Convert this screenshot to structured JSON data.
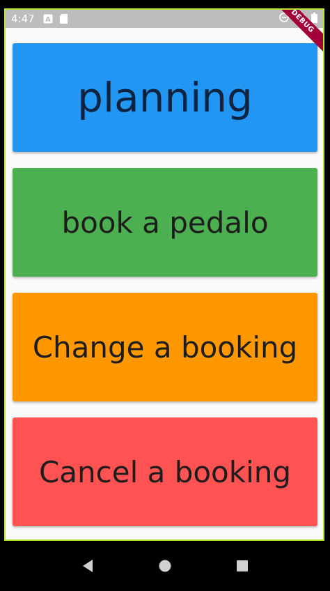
{
  "status_bar": {
    "time": "4:47",
    "debug_label": "DEBUG"
  },
  "menu": {
    "items": [
      {
        "label": "planning",
        "color": "#2196f3"
      },
      {
        "label": "book a pedalo",
        "color": "#4caf50"
      },
      {
        "label": "Change a booking",
        "color": "#ff9800"
      },
      {
        "label": "Cancel a booking",
        "color": "#ff5252"
      }
    ]
  },
  "icons": {
    "status": [
      "a-icon",
      "sd-card-icon",
      "do-not-disturb-icon",
      "wifi-icon",
      "battery-icon"
    ],
    "nav": [
      "back-icon",
      "home-icon",
      "recents-icon"
    ]
  }
}
